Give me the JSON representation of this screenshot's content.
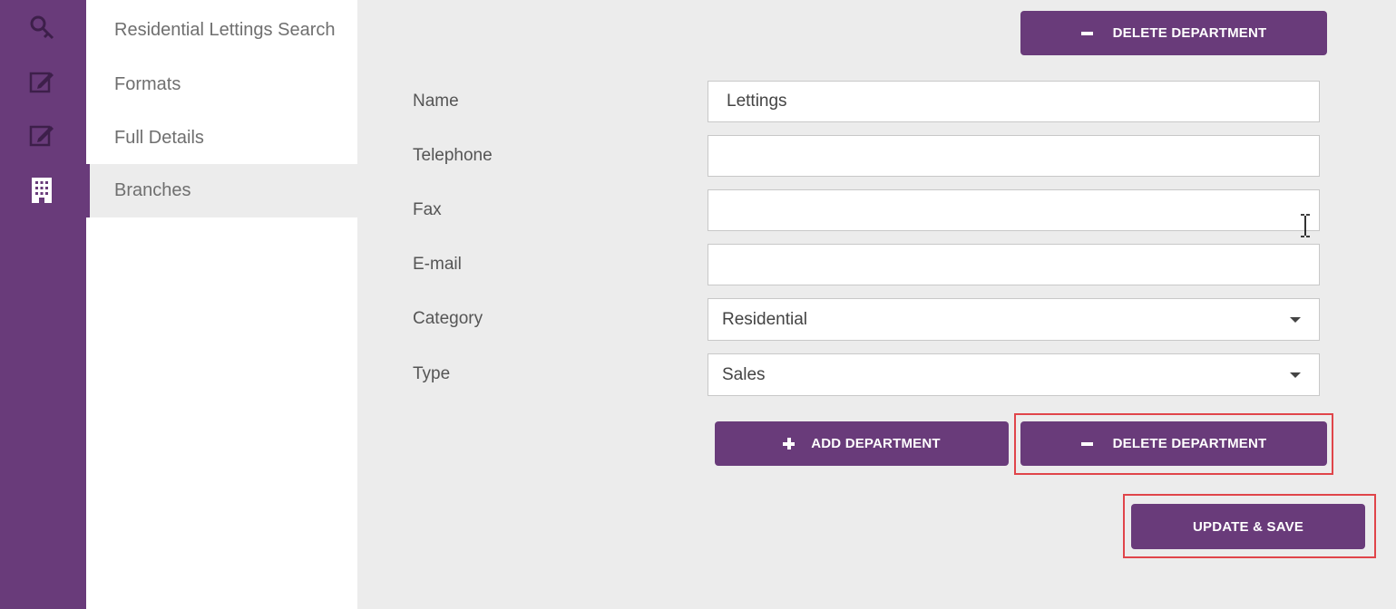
{
  "rail": {
    "icons": [
      "key-icon",
      "edit-icon",
      "edit-icon",
      "building-icon"
    ]
  },
  "submenu": {
    "items": [
      {
        "label": "Residential Lettings Search"
      },
      {
        "label": "Formats"
      },
      {
        "label": "Full Details"
      },
      {
        "label": "Branches",
        "active": true
      }
    ]
  },
  "top_delete_button": {
    "label": "DELETE DEPARTMENT"
  },
  "form": {
    "name": {
      "label": "Name",
      "value": "Lettings"
    },
    "telephone": {
      "label": "Telephone",
      "value": ""
    },
    "fax": {
      "label": "Fax",
      "value": ""
    },
    "email": {
      "label": "E-mail",
      "value": ""
    },
    "category": {
      "label": "Category",
      "value": "Residential"
    },
    "type": {
      "label": "Type",
      "value": "Sales"
    }
  },
  "actions": {
    "add_department": "ADD DEPARTMENT",
    "delete_department": "DELETE DEPARTMENT",
    "update_save": "UPDATE & SAVE"
  },
  "colors": {
    "brand": "#693b7a",
    "highlight": "#e0454a",
    "background": "#ececec"
  }
}
